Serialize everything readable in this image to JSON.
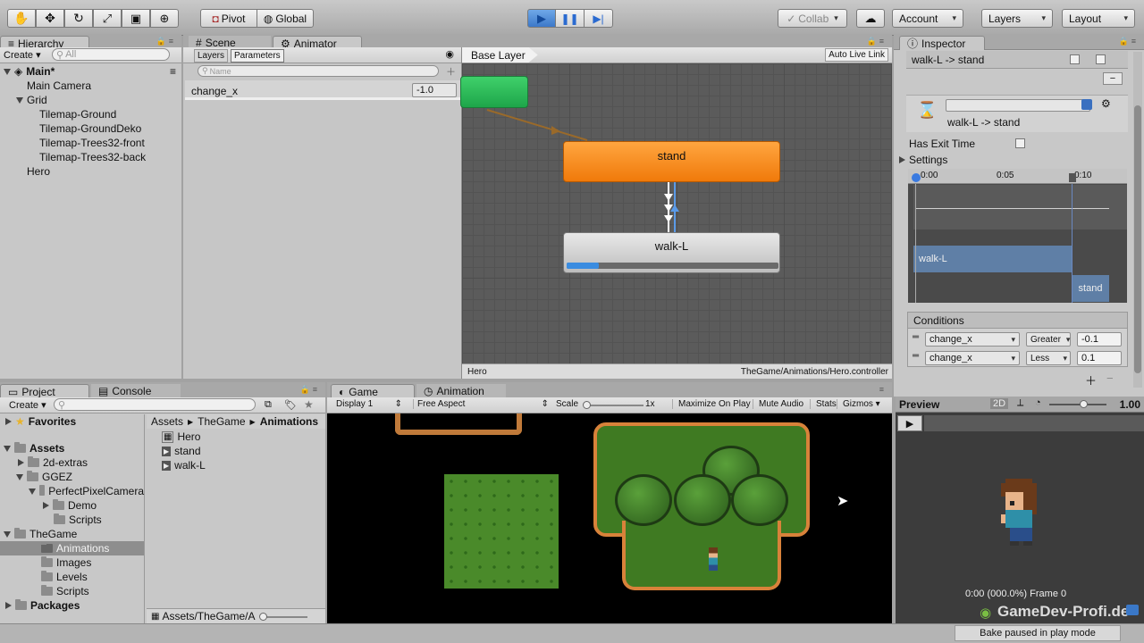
{
  "toolbar": {
    "tools": [
      "hand-icon",
      "move-icon",
      "rotate-icon",
      "scale-icon",
      "rect-icon",
      "transform-icon"
    ],
    "pivot_label": "Pivot",
    "global_label": "Global",
    "collab_label": "Collab",
    "account_label": "Account",
    "layers_label": "Layers",
    "layout_label": "Layout"
  },
  "hierarchy": {
    "tab": "Hierarchy",
    "create_label": "Create",
    "search_placeholder": "All",
    "scene_name": "Main*",
    "items": [
      "Main Camera",
      "Grid",
      "Tilemap-Ground",
      "Tilemap-GroundDeko",
      "Tilemap-Trees32-front",
      "Tilemap-Trees32-back",
      "Hero"
    ]
  },
  "scene_tabs": {
    "scene": "Scene",
    "animator": "Animator"
  },
  "animator": {
    "layers_tab": "Layers",
    "parameters_tab": "Parameters",
    "search_placeholder": "Name",
    "param_name": "change_x",
    "param_value": "-1.0",
    "breadcrumb": "Base Layer",
    "auto_live_link": "Auto Live Link",
    "state_stand": "stand",
    "state_walk": "walk-L",
    "walk_progress": 0.15,
    "footer_left": "Hero",
    "footer_right": "TheGame/Animations/Hero.controller"
  },
  "inspector": {
    "tab": "Inspector",
    "transition_title": "walk-L -> stand",
    "transition_subtitle": "walk-L -> stand",
    "has_exit_time_label": "Has Exit Time",
    "settings_label": "Settings",
    "timeline_ticks": [
      "0:00",
      "0:05",
      "0:10"
    ],
    "clip_from": "walk-L",
    "clip_to": "stand",
    "conditions_label": "Conditions",
    "conditions": [
      {
        "param": "change_x",
        "op": "Greater",
        "value": "-0.1"
      },
      {
        "param": "change_x",
        "op": "Less",
        "value": "0.1"
      }
    ]
  },
  "project": {
    "tab_project": "Project",
    "tab_console": "Console",
    "create_label": "Create",
    "favorites": "Favorites",
    "assets": "Assets",
    "tree": [
      "2d-extras",
      "GGEZ",
      "PerfectPixelCamera",
      "Demo",
      "Scripts",
      "TheGame",
      "Animations",
      "Images",
      "Levels",
      "Scripts"
    ],
    "packages": "Packages",
    "breadcrumb": [
      "Assets",
      "TheGame",
      "Animations"
    ],
    "files": [
      "Hero",
      "stand",
      "walk-L"
    ],
    "path": "Assets/TheGame/A"
  },
  "game": {
    "tab_game": "Game",
    "tab_animation": "Animation",
    "display": "Display 1",
    "aspect": "Free Aspect",
    "scale_label": "Scale",
    "scale_value": "1x",
    "maximize": "Maximize On Play",
    "mute": "Mute Audio",
    "stats": "Stats",
    "gizmos": "Gizmos"
  },
  "preview": {
    "title": "Preview",
    "mode": "2D",
    "speed": "1.00",
    "frame_info": "0:00 (000.0%) Frame 0",
    "watermark": "GameDev-Profi.de"
  },
  "status": {
    "bake": "Bake paused in play mode"
  }
}
